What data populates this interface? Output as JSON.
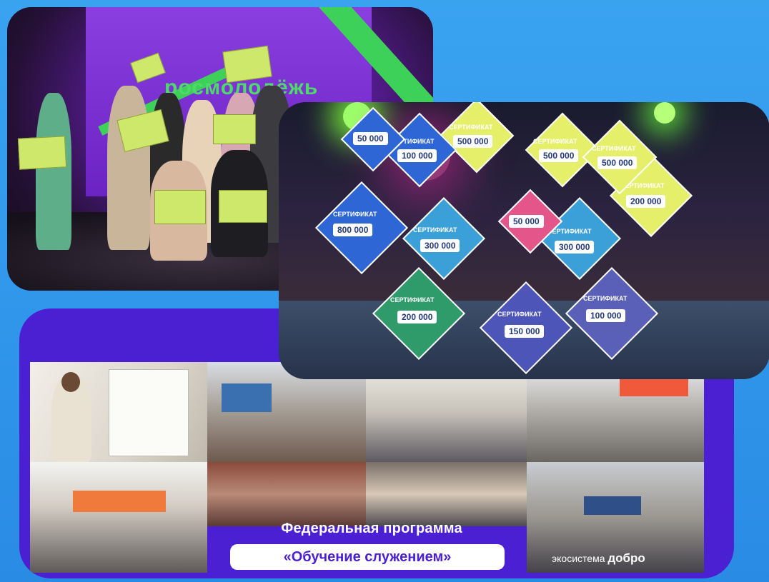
{
  "photo1": {
    "screen_text": "росмолодёжь"
  },
  "photo2": {
    "certificates": [
      {
        "title": "СЕРТИФИКАТ",
        "amount": "800 000"
      },
      {
        "title": "СЕРТИФИКАТ",
        "amount": "300 000"
      },
      {
        "title": "СЕРТИФИКАТ",
        "amount": "300 000"
      },
      {
        "title": "СЕРТИФИКАТ",
        "amount": "200 000"
      },
      {
        "title": "СЕРТИФИКАТ",
        "amount": "150 000"
      },
      {
        "title": "СЕРТИФИКАТ",
        "amount": "100 000"
      },
      {
        "title": "СЕРТИФИКАТ",
        "amount": "200 000"
      },
      {
        "title": "СЕРТИФИКАТ",
        "amount": "500 000"
      },
      {
        "title": "СЕРТИФИКАТ",
        "amount": "500 000"
      },
      {
        "title": "СЕРТИФИКАТ",
        "amount": "500 000"
      },
      {
        "title": "СЕРТИФИКАТ",
        "amount": "100 000"
      },
      {
        "title": "",
        "amount": "50 000"
      },
      {
        "title": "",
        "amount": "50 000"
      }
    ]
  },
  "caption": {
    "line1": "Федеральная программа",
    "line2": "«Обучение служением»"
  },
  "logo": {
    "prefix": "экосистема",
    "brand": "добро"
  },
  "colors": {
    "background": "#3aa3f0",
    "panel": "#4a20d2",
    "accent_green": "#3ed15a",
    "certificate_blue": "#2f66d6"
  }
}
